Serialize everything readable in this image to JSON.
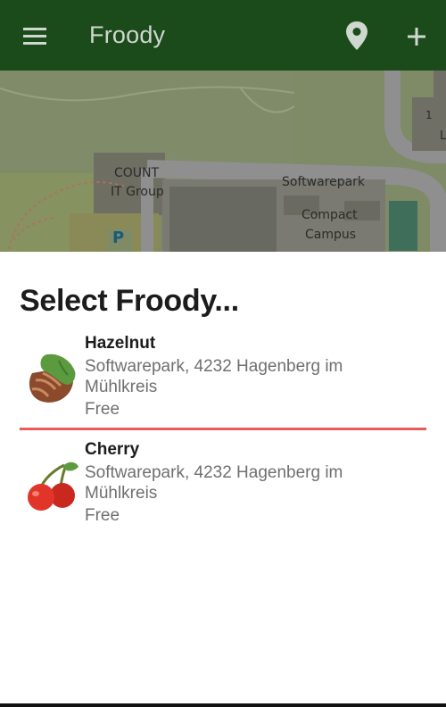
{
  "app": {
    "title": "Froody"
  },
  "toolbar": {
    "menu_icon": "menu-icon",
    "location_icon": "location-pin-icon",
    "add_icon": "plus-icon"
  },
  "map": {
    "labels": {
      "count": "COUNT",
      "it_group": "IT Group",
      "softwarepark": "Softwarepark",
      "compact": "Compact",
      "campus": "Campus",
      "parking": "P",
      "one": "1",
      "l": "L"
    }
  },
  "sheet": {
    "title": "Select Froody...",
    "items": [
      {
        "name": "Hazelnut",
        "address": "Softwarepark, 4232 Hagenberg im Mühlkreis",
        "price": "Free",
        "icon": "hazelnut-icon"
      },
      {
        "name": "Cherry",
        "address": "Softwarepark, 4232 Hagenberg im Mühlkreis",
        "price": "Free",
        "icon": "cherry-icon"
      }
    ]
  },
  "colors": {
    "appbar": "#1b4a1b",
    "divider": "#e95a5a",
    "text_primary": "#1c1c1c",
    "text_secondary": "#6f6f6f"
  }
}
